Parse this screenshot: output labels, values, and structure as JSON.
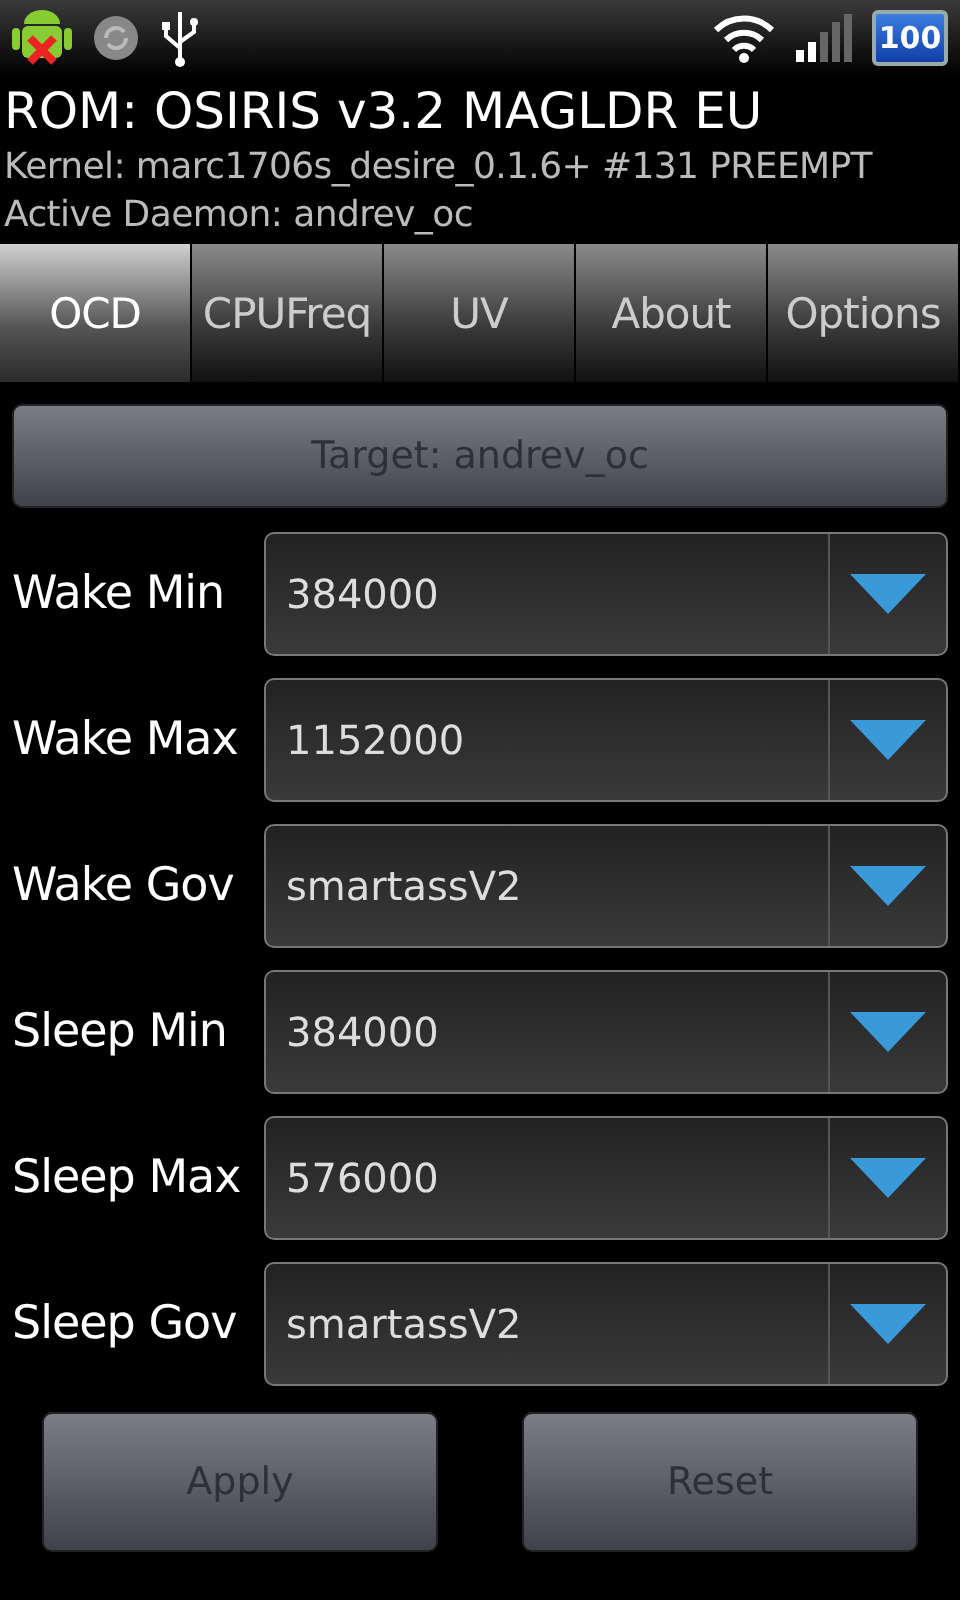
{
  "status_bar": {
    "battery": "100"
  },
  "header": {
    "title": "ROM: OSIRIS v3.2 MAGLDR EU",
    "kernel": "Kernel: marc1706s_desire_0.1.6+ #131 PREEMPT",
    "daemon": "Active Daemon: andrev_oc"
  },
  "tabs": [
    {
      "label": "OCD",
      "selected": true
    },
    {
      "label": "CPUFreq",
      "selected": false
    },
    {
      "label": "UV",
      "selected": false
    },
    {
      "label": "About",
      "selected": false
    },
    {
      "label": "Options",
      "selected": false
    }
  ],
  "target_button": {
    "label": "Target: andrev_oc",
    "disabled": true
  },
  "settings": [
    {
      "label": "Wake Min",
      "value": "384000"
    },
    {
      "label": "Wake Max",
      "value": "1152000"
    },
    {
      "label": "Wake Gov",
      "value": "smartassV2"
    },
    {
      "label": "Sleep Min",
      "value": "384000"
    },
    {
      "label": "Sleep Max",
      "value": "576000"
    },
    {
      "label": "Sleep Gov",
      "value": "smartassV2"
    }
  ],
  "buttons": [
    {
      "label": "Apply",
      "disabled": true
    },
    {
      "label": "Reset",
      "disabled": true
    }
  ]
}
